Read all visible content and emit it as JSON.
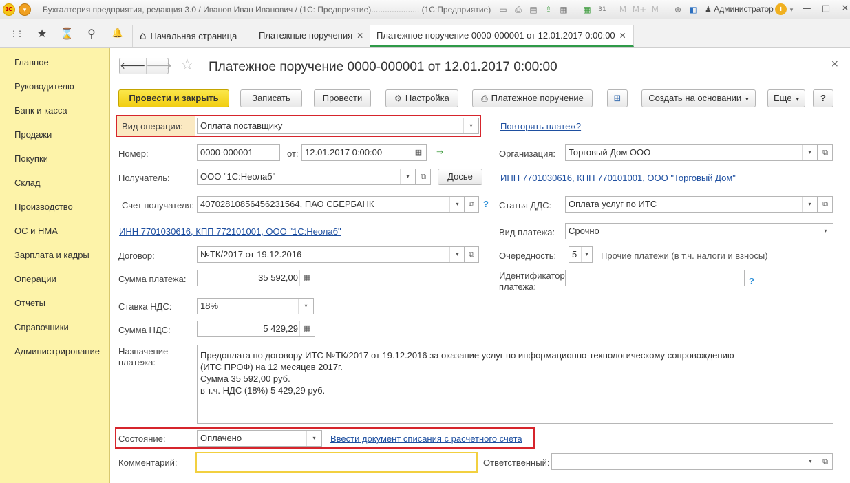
{
  "window": {
    "logo": "1С",
    "title": "Бухгалтерия предприятия, редакция 3.0 / Иванов Иван Иванович / (1С: Предприятие).....................  (1С:Предприятие)",
    "user": "Администратор",
    "icons": {
      "menu": "▾",
      "save": "▭",
      "print": "⎙",
      "preview": "▤",
      "upload": "⇪",
      "doc": "▦",
      "table": "▦",
      "calendar": "31",
      "m": "M",
      "mplus": "M+",
      "mminus": "M-",
      "zoom": "⊕",
      "panel": "◧",
      "user": "♟",
      "info": "i",
      "info_dd": "▾",
      "minimize": "—",
      "maximize": "□",
      "close": "✕"
    }
  },
  "tabsbar": {
    "icons": {
      "apps": "⋮⋮",
      "favorites": "★",
      "history": "⌛",
      "search": "⚲",
      "notifications": "🔔",
      "home": "⌂"
    },
    "tabs": [
      {
        "label": "Начальная страница"
      },
      {
        "label": "Платежные поручения",
        "close": "✕"
      },
      {
        "label": "Платежное поручение 0000-000001 от 12.01.2017 0:00:00",
        "close": "✕"
      }
    ]
  },
  "sidebar": {
    "items": [
      "Главное",
      "Руководителю",
      "Банк и касса",
      "Продажи",
      "Покупки",
      "Склад",
      "Производство",
      "ОС и НМА",
      "Зарплата и кадры",
      "Операции",
      "Отчеты",
      "Справочники",
      "Администрирование"
    ]
  },
  "document": {
    "back": "🡐",
    "forward": "🡒",
    "star": "☆",
    "title": "Платежное поручение 0000-000001 от 12.01.2017 0:00:00",
    "close": "×"
  },
  "toolbar": {
    "post_close": "Провести и закрыть",
    "save": "Записать",
    "post": "Провести",
    "settings": "Настройка",
    "settings_icon": "⚙",
    "print_order": "Платежное поручение",
    "print_icon": "⎙",
    "struct_icon": "⊞",
    "create_based": "Создать на основании",
    "more": "Еще",
    "help": "?",
    "caret": "▾"
  },
  "form": {
    "operation_type": {
      "label": "Вид операции:",
      "value": "Оплата поставщику"
    },
    "repeat_link": "Повторять платеж?",
    "number": {
      "label": "Номер:",
      "value": "0000-000001"
    },
    "date": {
      "label": "от:",
      "value": "12.01.2017  0:00:00",
      "icon": "▦",
      "post_icon": "⇒"
    },
    "organization": {
      "label": "Организация:",
      "value": "Торговый Дом ООО"
    },
    "recipient": {
      "label": "Получатель:",
      "value": "ООО \"1С:Неолаб\""
    },
    "dossier": "Досье",
    "org_link": "ИНН 7701030616, КПП 770101001, ООО \"Торговый Дом\"",
    "recipient_account": {
      "label": "Счет получателя:",
      "value": "40702810856456231564, ПАО СБЕРБАНК"
    },
    "dds_item": {
      "label": "Статья ДДС:",
      "value": "Оплата услуг по ИТС"
    },
    "recipient_link": "ИНН 7701030616, КПП 772101001, ООО \"1С:Неолаб\"",
    "payment_type": {
      "label": "Вид платежа:",
      "value": "Срочно"
    },
    "contract": {
      "label": "Договор:",
      "value": "№ТК/2017 от 19.12.2016"
    },
    "priority": {
      "label": "Очередность:",
      "value": "5",
      "description": "Прочие платежи (в т.ч. налоги и взносы)"
    },
    "amount": {
      "label": "Сумма платежа:",
      "value": "35 592,00"
    },
    "payment_id": {
      "label_line1": "Идентификатор",
      "label_line2": "платежа:",
      "value": ""
    },
    "vat_rate": {
      "label": "Ставка НДС:",
      "value": "18%"
    },
    "vat_amount": {
      "label": "Сумма НДС:",
      "value": "5 429,29"
    },
    "purpose": {
      "label_line1": "Назначение",
      "label_line2": "платежа:",
      "lines": [
        "Предоплата по договору ИТС №ТК/2017 от 19.12.2016 за оказание услуг по информационно-технологическому сопровождению",
        "(ИТС ПРОФ) на 12 месяцев 2017г.",
        "Сумма 35 592,00 руб.",
        "в т.ч. НДС  (18%) 5 429,29 руб."
      ]
    },
    "status": {
      "label": "Состояние:",
      "value": "Оплачено"
    },
    "writeoff_link": "Ввести документ списания с расчетного счета",
    "comment": {
      "label": "Комментарий:",
      "value": ""
    },
    "responsible": {
      "label": "Ответственный:",
      "value": ""
    },
    "icons": {
      "dropdown": "▾",
      "open": "⧉",
      "calc": "▦",
      "help": "?"
    }
  },
  "colors": {
    "sidebar": "#fdf3a9",
    "primary_button": "#f1cd12",
    "highlight": "#d6252c",
    "link": "#1e4fa0",
    "active_tab": "#2e9a48"
  }
}
